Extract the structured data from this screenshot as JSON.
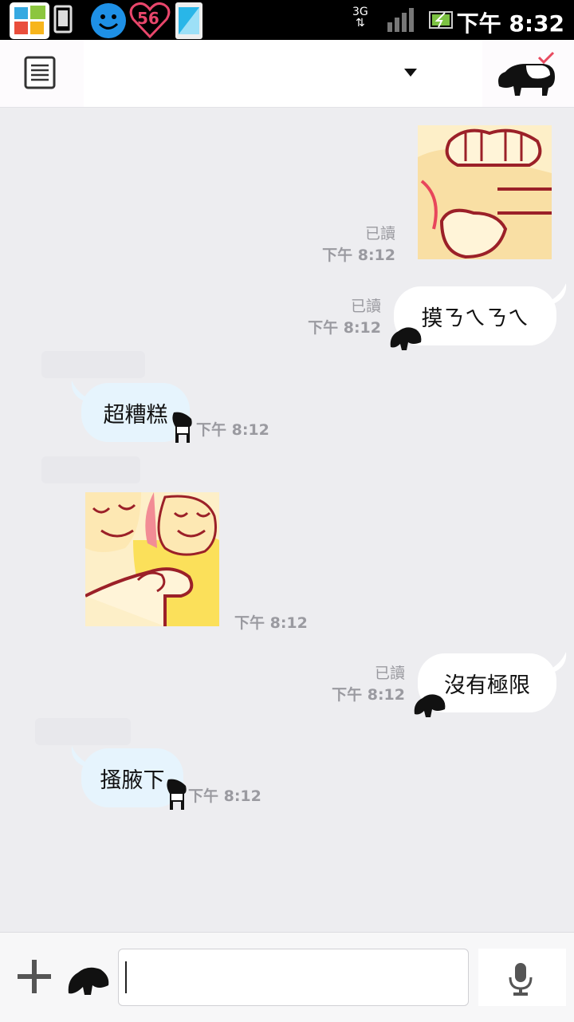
{
  "status_bar": {
    "time": "下午 8:32",
    "network": "3G",
    "heart_badge": "56"
  },
  "header": {
    "menu_icon": "menu-list-icon",
    "dropdown_icon": "caret-down-icon",
    "contact_icon": "tapir-icon"
  },
  "messages": [
    {
      "type": "sticker",
      "side": "out",
      "read": "已讀",
      "time": "下午 8:12",
      "icon": "massage-sticker"
    },
    {
      "type": "text",
      "side": "out",
      "text": "摸ㄋㄟㄋㄟ",
      "read": "已讀",
      "time": "下午 8:12"
    },
    {
      "type": "text",
      "side": "in",
      "text": "超糟糕",
      "time": "下午 8:12"
    },
    {
      "type": "sticker",
      "side": "in",
      "time": "下午 8:12",
      "icon": "hug-sticker"
    },
    {
      "type": "text",
      "side": "out",
      "text": "沒有極限",
      "read": "已讀",
      "time": "下午 8:12"
    },
    {
      "type": "text",
      "side": "in",
      "text": "搔腋下",
      "time": "下午 8:12"
    }
  ],
  "input_bar": {
    "plus_icon": "plus-icon",
    "sticker_icon": "tapir-sticker-icon",
    "text_value": "",
    "mic_icon": "microphone-icon"
  },
  "colors": {
    "bg": "#ededf0",
    "bubble_out": "#ffffff",
    "bubble_in": "#e6f4fd",
    "meta": "#9a9aa0"
  }
}
